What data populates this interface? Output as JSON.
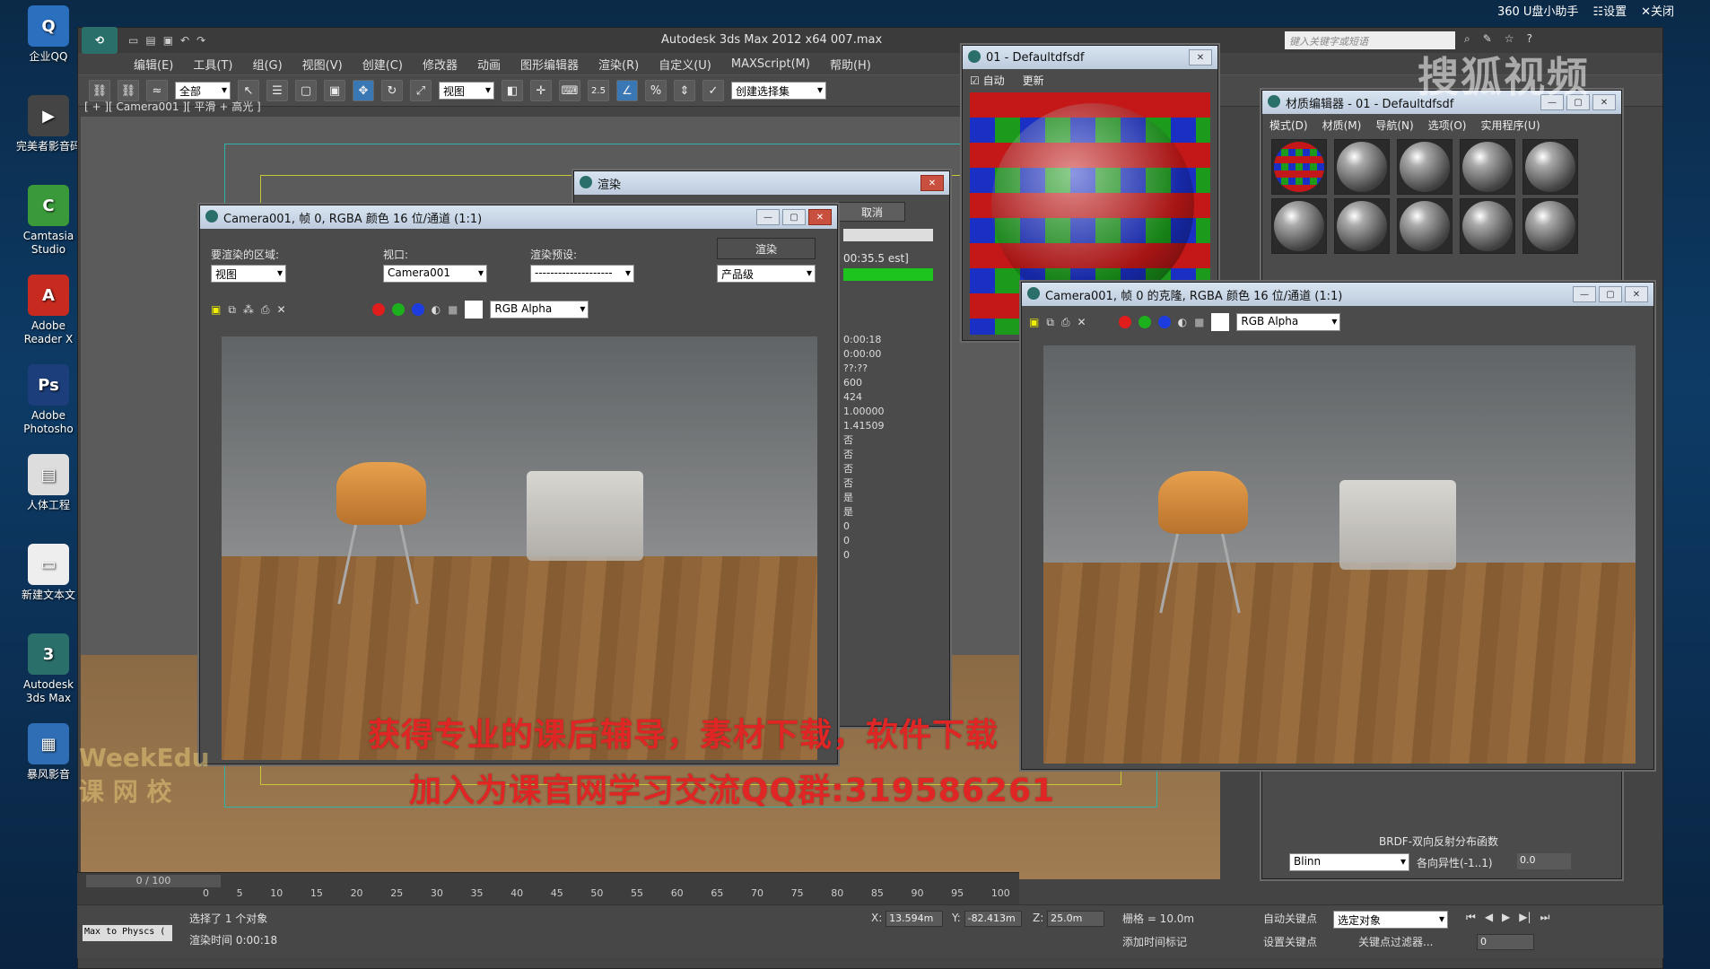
{
  "desktop": {
    "icons": [
      {
        "label": "企业QQ",
        "glyph": "Q",
        "color": "#2b6fbf"
      },
      {
        "label": "完美者影音码",
        "glyph": "▶",
        "color": "#444"
      },
      {
        "label": "Camtasia Studio",
        "glyph": "C",
        "color": "#3a9a3a"
      },
      {
        "label": "Adobe Reader X",
        "glyph": "A",
        "color": "#c72a1f"
      },
      {
        "label": "Adobe Photosho",
        "glyph": "Ps",
        "color": "#1c3e7a"
      },
      {
        "label": "人体工程",
        "glyph": "▤",
        "color": "#ddd"
      },
      {
        "label": "新建文本文",
        "glyph": "▭",
        "color": "#eee"
      },
      {
        "label": "Autodesk 3ds Max",
        "glyph": "3",
        "color": "#2a6f6a"
      },
      {
        "label": "暴风影音",
        "glyph": "▦",
        "color": "#2f6db5"
      }
    ]
  },
  "top_bar": {
    "assistant": "360 U盘小助手",
    "settings": "☷设置",
    "close": "✕关闭"
  },
  "app": {
    "title": "Autodesk 3ds Max  2012 x64      007.max",
    "search_placeholder": "键入关键字或短语",
    "menus": [
      "编辑(E)",
      "工具(T)",
      "组(G)",
      "视图(V)",
      "创建(C)",
      "修改器",
      "动画",
      "图形编辑器",
      "渲染(R)",
      "自定义(U)",
      "MAXScript(M)",
      "帮助(H)"
    ],
    "toolbar": {
      "selection_filter": "全部",
      "ref_coord": "视图",
      "snap_label": "2.5",
      "named_selection": "创建选择集"
    },
    "viewport_label": "[ + ][ Camera001 ][ 平滑 + 高光 ]"
  },
  "render_frame": {
    "title": "Camera001, 帧 0, RGBA 颜色 16 位/通道 (1:1)",
    "area_label": "要渲染的区域:",
    "area_value": "视图",
    "viewport_label": "视口:",
    "viewport_value": "Camera001",
    "preset_label": "渲染预设:",
    "preset_value": "--------------------",
    "render_button": "渲染",
    "quality_value": "产品级",
    "channel_value": "RGB Alpha"
  },
  "render_progress": {
    "title": "渲染",
    "cancel": "取消",
    "time": "00:35.5 est]",
    "stats": [
      "0:00:18",
      "0:00:00",
      "??:??",
      "600",
      "424",
      "1.00000",
      "1.41509",
      "否",
      "否",
      "否",
      "否",
      "是",
      "是",
      "0",
      "0",
      "0"
    ]
  },
  "material_preview": {
    "title": "01 - Defaultdfsdf",
    "auto": "自动",
    "update": "更新"
  },
  "material_editor": {
    "title": "材质编辑器 - 01 - Defaultdfsdf",
    "menus": [
      "模式(D)",
      "材质(M)",
      "导航(N)",
      "选项(O)",
      "实用程序(U)"
    ],
    "brdf_label": "BRDF-双向反射分布函数",
    "shader": "Blinn",
    "aniso_label": "各向异性(-1..1)",
    "aniso_value": "0.0"
  },
  "clone_frame": {
    "title": "Camera001, 帧 0 的克隆, RGBA 颜色 16 位/通道 (1:1)",
    "channel_value": "RGB Alpha"
  },
  "timeline": {
    "position": "0 / 100",
    "ticks": [
      "0",
      "5",
      "10",
      "15",
      "20",
      "25",
      "30",
      "35",
      "40",
      "45",
      "50",
      "55",
      "60",
      "65",
      "70",
      "75",
      "80",
      "85",
      "90",
      "95",
      "100"
    ]
  },
  "status": {
    "selection": "选择了 1 个对象",
    "render_time": "渲染时间  0:00:18",
    "script": "Max to Physcs (",
    "x": "13.594m",
    "y": "-82.413m",
    "z": "25.0m",
    "grid": "栅格 = 10.0m",
    "add_tag": "添加时间标记",
    "auto_key": "自动关键点",
    "selected": "选定对象",
    "set_key": "设置关键点",
    "key_filter": "关键点过滤器...",
    "frame": "0"
  },
  "overlay": {
    "ad_line1": "获得专业的课后辅导，素材下载，软件下载",
    "ad_line2": "加入为课官网学习交流QQ群:319586261",
    "watermark_brand": "WeekEdu",
    "watermark_cn": "课 网 校",
    "sohu": "搜狐视频"
  }
}
